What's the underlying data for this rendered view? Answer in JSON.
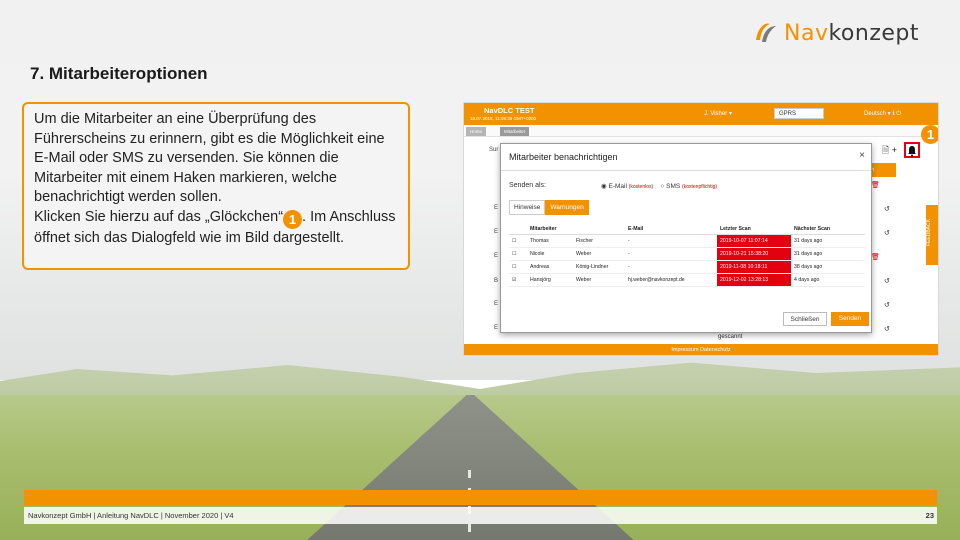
{
  "logo": {
    "prefix": "Nav",
    "suffix": "konzept"
  },
  "title": "7. Mitarbeiteroptionen",
  "body": {
    "paragraph1": "Um die Mitarbeiter an eine Überprüfung des Führerscheins zu erinnern, gibt es die Möglichkeit eine E-Mail oder SMS zu versenden. Sie können die Mitarbeiter mit einem Haken markieren, welche benachrichtigt werden sollen.",
    "paragraph2_before": "Klicken Sie hierzu auf das „Glöckchen“",
    "badge": "1",
    "paragraph2_after": ". Im Anschluss öffnet sich das Dialogfeld wie im Bild dargestellt."
  },
  "screenshot": {
    "brand": "NavDLC TEST",
    "date": "18.07.2018, 11:08:39 GMT+0200",
    "user": "J. Visher ▾",
    "gprs": "GPRS",
    "lang": "Deutsch ▾  ℹ  ⏻",
    "crumbs": [
      "Home",
      "Mitarbeiter"
    ],
    "badge": "1",
    "right_header": "onen",
    "gescannt": "gescannt",
    "footer": "Impressum    Datenschutz",
    "feedback": "FEEDBACK",
    "side_letters": [
      "Sur",
      "E",
      "E",
      "E",
      "B",
      "E",
      "E"
    ],
    "modal": {
      "title": "Mitarbeiter benachrichtigen",
      "close": "×",
      "send_as": "Senden als:",
      "opt_email": "◉ E-Mail",
      "opt_email_note": "(kostenlos)",
      "opt_sms": "○ SMS",
      "opt_sms_note": "(kostenpflichtig)",
      "tab_hint": "Hinweise",
      "tab_warn": "Warnungen",
      "columns": [
        "",
        "Mitarbeiter",
        "",
        "E-Mail",
        "Letzter Scan",
        "Nächster Scan"
      ],
      "rows": [
        {
          "check": "☐",
          "first": "Thomas",
          "last": "Fischer",
          "mail": "-",
          "scan": "2019-10-07 11:07:14",
          "next": "31 days ago"
        },
        {
          "check": "☐",
          "first": "Nicole",
          "last": "Weber",
          "mail": "-",
          "scan": "2019-10-21 15:38:20",
          "next": "31 days ago"
        },
        {
          "check": "☐",
          "first": "Andreas",
          "last": "König-Lindner",
          "mail": "-",
          "scan": "2019-11-08 10:18:11",
          "next": "38 days ago"
        },
        {
          "check": "☑",
          "first": "Hansjörg",
          "last": "Weber",
          "mail": "hj.weber@navkonzept.de",
          "scan": "2019-12-02 13:28:13",
          "next": "4 days ago"
        }
      ],
      "btn_close": "Schließen",
      "btn_send": "Senden"
    }
  },
  "footer": {
    "text": "Navkonzept GmbH  |  Anleitung NavDLC  |  November 2020  |  V4",
    "page": "23"
  },
  "colors": {
    "accent": "#f39200",
    "alert": "#e3000f"
  }
}
